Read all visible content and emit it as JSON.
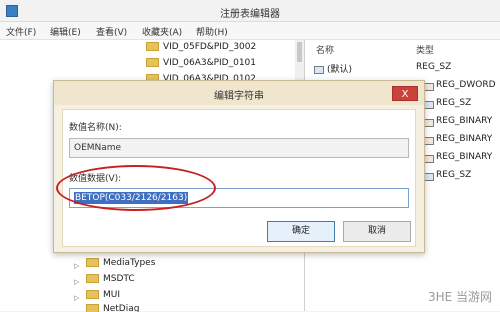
{
  "window": {
    "title": "注册表编辑器"
  },
  "menu": [
    "文件(F)",
    "编辑(E)",
    "查看(V)",
    "收藏夹(A)",
    "帮助(H)"
  ],
  "tree": {
    "top_items": [
      "VID_05FD&PID_3002",
      "VID_06A3&PID_0101",
      "VID_06A3&PID_0102"
    ],
    "bottom_items": [
      "MediaTypes",
      "MSDTC",
      "MUI",
      "NetDiag"
    ]
  },
  "values": {
    "headers": {
      "name": "名称",
      "type": "类型"
    },
    "rows": [
      {
        "name": "(默认)",
        "type": "REG_SZ"
      },
      {
        "name": "",
        "type": "REG_DWORD"
      },
      {
        "name": "",
        "type": "REG_SZ"
      },
      {
        "name": "",
        "type": "REG_BINARY"
      },
      {
        "name": "",
        "type": "REG_BINARY"
      },
      {
        "name": "",
        "type": "REG_BINARY"
      },
      {
        "name": "",
        "type": "REG_SZ"
      }
    ]
  },
  "dialog": {
    "title": "编辑字符串",
    "close_label": "X",
    "name_label": "数值名称(N):",
    "name_value": "OEMName",
    "data_label": "数值数据(V):",
    "data_value": "BETOP(C033/2126/2163)",
    "ok_label": "确定",
    "cancel_label": "取消"
  },
  "watermark": "3HE 当游网"
}
